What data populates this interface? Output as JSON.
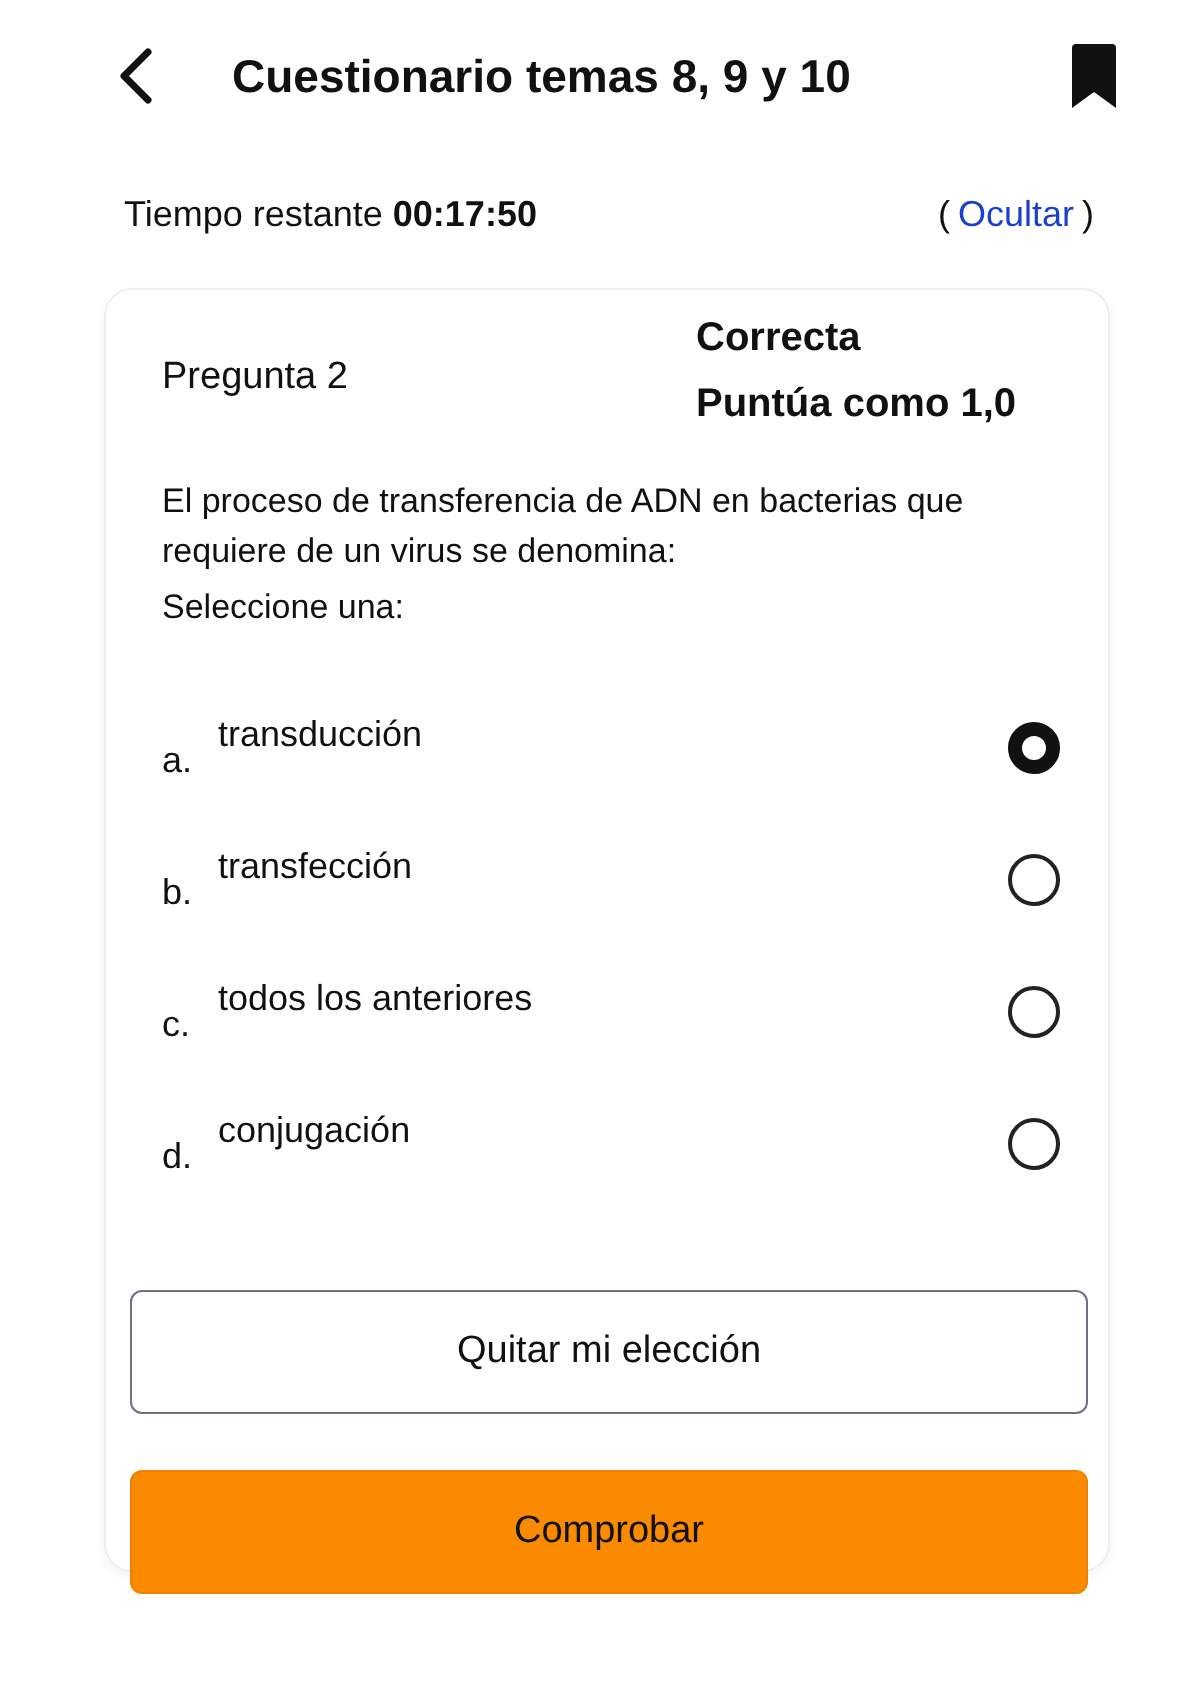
{
  "header": {
    "title": "Cuestionario temas 8, 9 y 10"
  },
  "timer": {
    "text": "Tiempo restante **00:17:50**",
    "hide_link": {
      "open": "(",
      "label": "Ocultar",
      "close": ")"
    }
  },
  "question": {
    "number": "Pregunta 2",
    "status": "Correcta",
    "mark": "Puntúa como 1,0",
    "text": "El proceso de transferencia de ADN en bacterias que requiere de un virus se denomina:",
    "prompt": "Seleccione una:",
    "options": [
      {
        "letter": "a.",
        "label": "transducción",
        "selected": true
      },
      {
        "letter": "b.",
        "label": "transfección",
        "selected": false
      },
      {
        "letter": "c.",
        "label": "todos los anteriores",
        "selected": false
      },
      {
        "letter": "d.",
        "label": "conjugación",
        "selected": false
      }
    ]
  },
  "buttons": [
    {
      "kind": "outline",
      "label": "Quitar mi elección"
    },
    {
      "kind": "primary",
      "label": "Comprobar"
    }
  ]
}
